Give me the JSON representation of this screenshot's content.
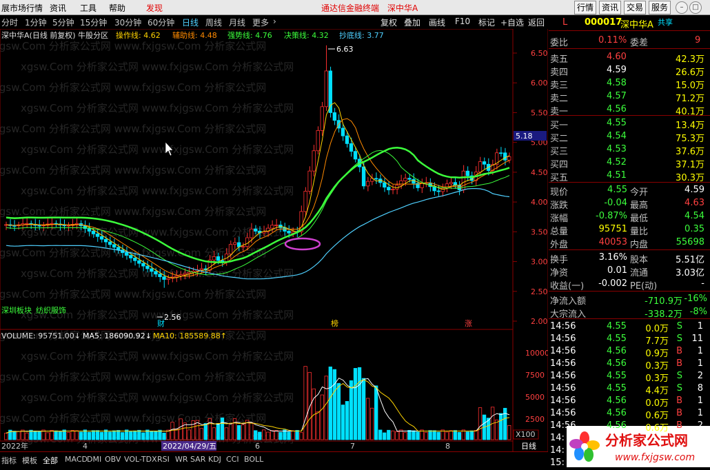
{
  "menu": {
    "items": [
      "展市场行情",
      "资讯",
      "工具",
      "帮助",
      "发现"
    ],
    "center_title": "通达信金融终端",
    "stock_name": "深中华A",
    "right_buttons": [
      "行情",
      "资讯",
      "交易",
      "服务"
    ]
  },
  "periods": {
    "items": [
      "分时",
      "1分钟",
      "5分钟",
      "15分钟",
      "30分钟",
      "60分钟",
      "日线",
      "周线",
      "月线",
      "更多"
    ],
    "active": "日线"
  },
  "toolbar": {
    "items": [
      "复权",
      "叠加",
      "画线",
      "F10",
      "标记",
      "+自选",
      "返回"
    ]
  },
  "indicator_header": {
    "prefix": "深中华A(日线 前复权) 牛股分区",
    "lines": [
      {
        "label": "操作线: 4.62",
        "color": "#ffd400"
      },
      {
        "label": "辅助线: 4.48",
        "color": "#ff8a00"
      },
      {
        "label": "强势线: 4.76",
        "color": "#3cff3c"
      },
      {
        "label": "决策线: 4.32",
        "color": "#3cff3c"
      },
      {
        "label": "抄底线: 3.77",
        "color": "#4fd0ff"
      }
    ]
  },
  "price_axis": {
    "ticks": [
      "6.50",
      "6.00",
      "5.50",
      "5.00",
      "4.50",
      "4.00",
      "3.50",
      "3.00",
      "2.50",
      "2.00"
    ],
    "current_label": "5.18"
  },
  "annotations": {
    "high_label": "6.63",
    "low_label": "2.56",
    "board_labels": [
      "深圳板块",
      "纺织服饰"
    ],
    "event_tags": [
      "财",
      "榜",
      "涨"
    ]
  },
  "volume_header": {
    "volume": "VOLUME: 95751.00↓",
    "ma5": "MA5: 186090.92↓",
    "ma10": "MA10: 185589.88↑"
  },
  "volume_axis": {
    "ticks": [
      "10000",
      "7500",
      "5000",
      "2500"
    ],
    "unit": "X100"
  },
  "date_axis": {
    "year": "2022年",
    "labels": [
      "4",
      "2022/04/29/五",
      "6",
      "7",
      "8"
    ],
    "period_label": "日线"
  },
  "bottom_tabs": [
    "指标",
    "模板",
    "全部",
    "MACD",
    "DMI",
    "OBV",
    "VOL-TDX",
    "RSI",
    "WR",
    "SAR",
    "KDJ",
    "CCI",
    "BOLL"
  ],
  "quote": {
    "code": "000017",
    "name": "深中华A",
    "share_label": "共享",
    "l_label": "L",
    "weibi_label": "委比",
    "weibi": "0.11%",
    "weicha_label": "委差",
    "weicha": "9",
    "asks": [
      {
        "label": "卖五",
        "price": "4.60",
        "vol": "42.3万"
      },
      {
        "label": "卖四",
        "price": "4.59",
        "vol": "26.6万"
      },
      {
        "label": "卖三",
        "price": "4.58",
        "vol": "15.0万"
      },
      {
        "label": "卖二",
        "price": "4.57",
        "vol": "71.2万"
      },
      {
        "label": "卖一",
        "price": "4.56",
        "vol": "40.1万"
      }
    ],
    "bids": [
      {
        "label": "买一",
        "price": "4.55",
        "vol": "13.4万"
      },
      {
        "label": "买二",
        "price": "4.54",
        "vol": "75.3万"
      },
      {
        "label": "买三",
        "price": "4.53",
        "vol": "37.6万"
      },
      {
        "label": "买四",
        "price": "4.52",
        "vol": "37.1万"
      },
      {
        "label": "买五",
        "price": "4.51",
        "vol": "30.3万"
      }
    ],
    "stats": [
      {
        "l1": "现价",
        "v1": "4.55",
        "c1": "#3cff3c",
        "l2": "今开",
        "v2": "4.59",
        "c2": "#ffffff"
      },
      {
        "l1": "涨跌",
        "v1": "-0.04",
        "c1": "#3cff3c",
        "l2": "最高",
        "v2": "4.63",
        "c2": "#ff4040"
      },
      {
        "l1": "涨幅",
        "v1": "-0.87%",
        "c1": "#3cff3c",
        "l2": "最低",
        "v2": "4.54",
        "c2": "#3cff3c"
      },
      {
        "l1": "总量",
        "v1": "95751",
        "c1": "#ffff00",
        "l2": "量比",
        "v2": "0.35",
        "c2": "#3cff3c"
      },
      {
        "l1": "外盘",
        "v1": "40053",
        "c1": "#ff4040",
        "l2": "内盘",
        "v2": "55698",
        "c2": "#3cff3c"
      }
    ],
    "stats2": [
      {
        "l1": "换手",
        "v1": "3.16%",
        "l2": "股本",
        "v2": "5.51亿"
      },
      {
        "l1": "净资",
        "v1": "0.01",
        "l2": "流通",
        "v2": "3.03亿"
      },
      {
        "l1": "收益(一)",
        "v1": "-0.002",
        "l2": "PE(动)",
        "v2": "-"
      }
    ],
    "flows": [
      {
        "label": "净流入额",
        "value": "-710.9万",
        "pct": "-16%"
      },
      {
        "label": "大宗流入",
        "value": "-338.2万",
        "pct": "-8%"
      }
    ],
    "ticks": [
      {
        "time": "14:56",
        "price": "4.55",
        "vol": "0.0万",
        "side": "S",
        "n": "1"
      },
      {
        "time": "14:56",
        "price": "4.55",
        "vol": "7.7万",
        "side": "S",
        "n": "11"
      },
      {
        "time": "14:56",
        "price": "4.56",
        "vol": "0.9万",
        "side": "B",
        "n": "1"
      },
      {
        "time": "14:56",
        "price": "4.56",
        "vol": "0.3万",
        "side": "B",
        "n": "1"
      },
      {
        "time": "14:56",
        "price": "4.55",
        "vol": "0.3万",
        "side": "S",
        "n": "2"
      },
      {
        "time": "14:56",
        "price": "4.55",
        "vol": "4.4万",
        "side": "S",
        "n": "8"
      },
      {
        "time": "14:56",
        "price": "4.56",
        "vol": "0.0万",
        "side": "B",
        "n": "1"
      },
      {
        "time": "14:56",
        "price": "4.56",
        "vol": "0.6万",
        "side": "B",
        "n": "1"
      },
      {
        "time": "14:56",
        "price": "4.56",
        "vol": "0.6万",
        "side": "B",
        "n": "2"
      },
      {
        "time": "14:",
        "price": "",
        "vol": "",
        "side": "",
        "n": ""
      },
      {
        "time": "14:",
        "price": "",
        "vol": "",
        "side": "",
        "n": ""
      },
      {
        "time": "15:",
        "price": "",
        "vol": "",
        "side": "",
        "n": ""
      }
    ]
  },
  "watermark": {
    "text": "分析家公式网",
    "url": "www.fxjgsw.com",
    "repeat": "xgsw.Com 分析家公式网 www.fxjgsw.Com 分析家公式网"
  },
  "colors": {
    "up": "#ff3030",
    "down": "#00e0ff",
    "green": "#3cff3c",
    "yellow": "#ffd400",
    "orange": "#ff8a00",
    "cyan": "#4fd0ff",
    "magenta": "#d040d0"
  }
}
